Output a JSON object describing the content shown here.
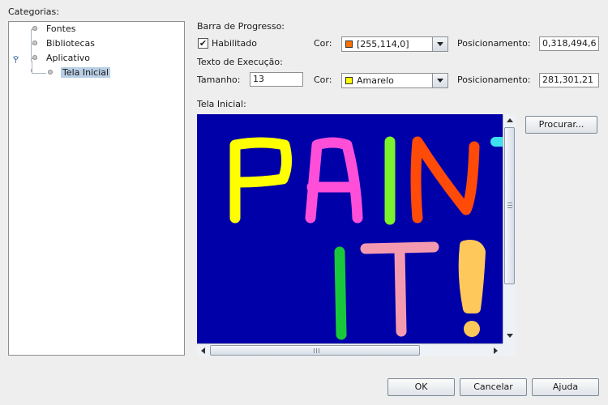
{
  "categorias": {
    "label": "Categorias:",
    "items": [
      {
        "label": "Fontes"
      },
      {
        "label": "Bibliotecas"
      },
      {
        "label": "Aplicativo"
      },
      {
        "label": "Tela Inicial",
        "selected": true
      }
    ]
  },
  "barra_progresso": {
    "label": "Barra de Progresso:",
    "habilitado_label": "Habilitado",
    "habilitado_checked": true,
    "habilitado_mark": "✔",
    "cor_label": "Cor:",
    "cor_value": "[255,114,0]",
    "cor_swatch": "#ff7200",
    "posicionamento_label": "Posicionamento:",
    "posicionamento_value": "0,318,494,6"
  },
  "texto_execucao": {
    "label": "Texto de Execução:",
    "tamanho_label": "Tamanho:",
    "tamanho_value": "13",
    "cor_label": "Cor:",
    "cor_value": "Amarelo",
    "cor_swatch": "#ffff00",
    "posicionamento_label": "Posicionamento:",
    "posicionamento_value": "281,301,21"
  },
  "tela_inicial": {
    "label": "Tela Inicial:",
    "procurar_label": "Procurar...",
    "image_description_icon": "splash-image",
    "background": "#0000a8"
  },
  "buttons": {
    "ok": "OK",
    "cancelar": "Cancelar",
    "ajuda": "Ajuda"
  }
}
